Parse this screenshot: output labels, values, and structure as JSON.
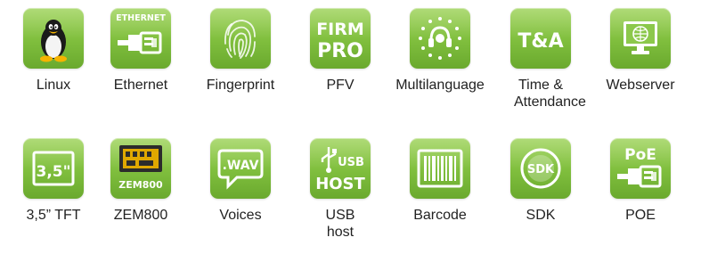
{
  "row1": [
    {
      "label": "Linux",
      "icon": "linux-penguin-icon"
    },
    {
      "label": "Ethernet",
      "icon": "ethernet-icon",
      "icon_text": "ETHERNET"
    },
    {
      "label": "Fingerprint",
      "icon": "fingerprint-icon"
    },
    {
      "label": "PFV",
      "icon": "firm-pro-icon",
      "icon_text_1": "FIRM",
      "icon_text_2": "PRO"
    },
    {
      "label": "Multilanguage",
      "icon": "multilanguage-icon"
    },
    {
      "label": "Time & Attendance",
      "icon": "time-attendance-icon",
      "icon_text": "T&A"
    },
    {
      "label": "Webserver",
      "icon": "webserver-icon"
    }
  ],
  "row2": [
    {
      "label": "3,5” TFT",
      "icon": "tft-screen-icon",
      "icon_text": "3,5\""
    },
    {
      "label": "ZEM800",
      "icon": "zem800-chip-icon",
      "icon_text": "ZEM800"
    },
    {
      "label": "Voices",
      "icon": "wav-voice-icon",
      "icon_text": ".WAV"
    },
    {
      "label": "USB host",
      "icon": "usb-host-icon",
      "icon_text_1": "USB",
      "icon_text_2": "HOST"
    },
    {
      "label": "Barcode",
      "icon": "barcode-icon"
    },
    {
      "label": "SDK",
      "icon": "sdk-icon",
      "icon_text": "SDK"
    },
    {
      "label": "POE",
      "icon": "poe-icon",
      "icon_text": "PoE"
    }
  ],
  "colors": {
    "tile_green": "#7fbe3d",
    "label_text": "#222222"
  }
}
